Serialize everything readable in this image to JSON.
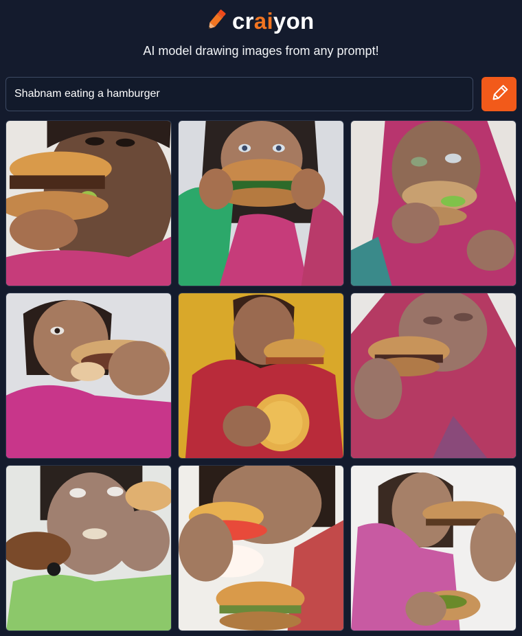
{
  "brand": {
    "prefix": "cr",
    "accent": "ai",
    "suffix": "yon",
    "accent_color": "#f27521",
    "logo_icon": "pencil-icon"
  },
  "tagline": "AI model drawing images from any prompt!",
  "search": {
    "value": "Shabnam eating a hamburger",
    "button_icon": "pencil-icon",
    "button_color": "#f25a1a"
  },
  "results": {
    "count": 9,
    "images": [
      {
        "subject": "woman-eating-burger",
        "background": "#e9e6e2",
        "clothing": "#c63c7a"
      },
      {
        "subject": "woman-eating-burger",
        "background": "#d9dbe0",
        "clothing": "#c63c7a"
      },
      {
        "subject": "woman-eating-burger",
        "background": "#e7e3df",
        "clothing": "#b8356e"
      },
      {
        "subject": "woman-eating-burger",
        "background": "#dedfe3",
        "clothing": "#c8368a"
      },
      {
        "subject": "woman-eating-burger",
        "background": "#d9a82a",
        "clothing": "#b92b3a"
      },
      {
        "subject": "woman-eating-burger",
        "background": "#e8e6e4",
        "clothing": "#b53a63"
      },
      {
        "subject": "woman-eating-burger",
        "background": "#e4e6e3",
        "clothing": "#8cc86a"
      },
      {
        "subject": "woman-eating-burger",
        "background": "#f0eeea",
        "clothing": "#c24a4a"
      },
      {
        "subject": "woman-eating-burger",
        "background": "#f1f0ef",
        "clothing": "#c85aa2"
      }
    ]
  }
}
